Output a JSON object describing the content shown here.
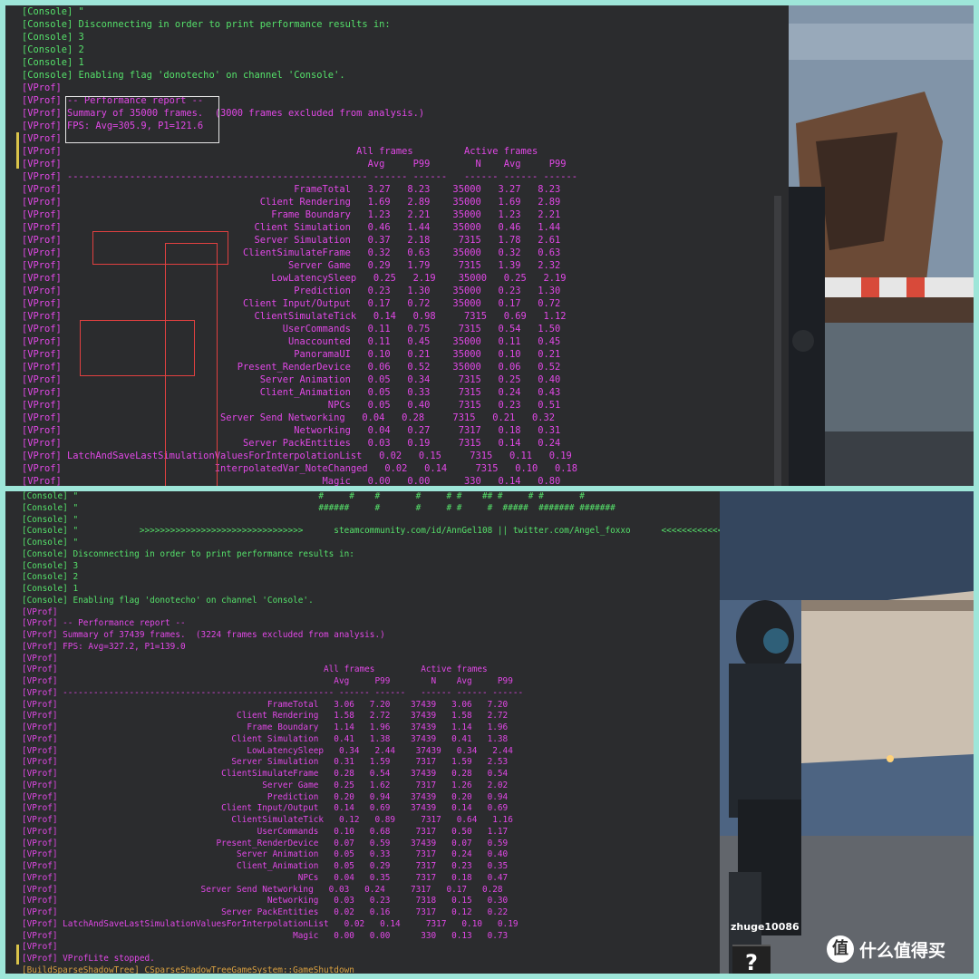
{
  "top_lines": [
    {
      "type": "console",
      "text": "[Console] \""
    },
    {
      "type": "console",
      "text": "[Console] Disconnecting in order to print performance results in:"
    },
    {
      "type": "console",
      "text": "[Console] 3"
    },
    {
      "type": "console",
      "text": "[Console] 2"
    },
    {
      "type": "console",
      "text": "[Console] 1"
    },
    {
      "type": "console",
      "text": "[Console] Enabling flag 'donotecho' on channel 'Console'."
    },
    {
      "type": "vprof",
      "text": "[VProf]"
    },
    {
      "type": "vprof",
      "text": "[VProf] -- Performance report --"
    },
    {
      "type": "vprof",
      "text": "[VProf] Summary of 35000 frames.  (3000 frames excluded from analysis.)"
    },
    {
      "type": "vprof",
      "text": "[VProf] FPS: Avg=305.9, P1=121.6"
    },
    {
      "type": "vprof",
      "text": "[VProf]"
    },
    {
      "type": "vprof",
      "text": "[VProf]                                                    All frames         Active frames"
    },
    {
      "type": "vprof",
      "text": "[VProf]                                                      Avg     P99        N    Avg     P99"
    },
    {
      "type": "vprof",
      "text": "[VProf] ----------------------------------------------------- ------ ------   ------ ------ ------"
    },
    {
      "type": "vprof",
      "text": "[VProf]                                         FrameTotal   3.27   8.23    35000   3.27   8.23"
    },
    {
      "type": "vprof",
      "text": "[VProf]                                   Client Rendering   1.69   2.89    35000   1.69   2.89"
    },
    {
      "type": "vprof",
      "text": "[VProf]                                     Frame Boundary   1.23   2.21    35000   1.23   2.21"
    },
    {
      "type": "vprof",
      "text": "[VProf]                                  Client Simulation   0.46   1.44    35000   0.46   1.44"
    },
    {
      "type": "vprof",
      "text": "[VProf]                                  Server Simulation   0.37   2.18     7315   1.78   2.61"
    },
    {
      "type": "vprof",
      "text": "[VProf]                                ClientSimulateFrame   0.32   0.63    35000   0.32   0.63"
    },
    {
      "type": "vprof",
      "text": "[VProf]                                        Server Game   0.29   1.79     7315   1.39   2.32"
    },
    {
      "type": "vprof",
      "text": "[VProf]                                     LowLatencySleep   0.25   2.19    35000   0.25   2.19"
    },
    {
      "type": "vprof",
      "text": "[VProf]                                         Prediction   0.23   1.30    35000   0.23   1.30"
    },
    {
      "type": "vprof",
      "text": "[VProf]                                Client Input/Output   0.17   0.72    35000   0.17   0.72"
    },
    {
      "type": "vprof",
      "text": "[VProf]                                  ClientSimulateTick   0.14   0.98     7315   0.69   1.12"
    },
    {
      "type": "vprof",
      "text": "[VProf]                                       UserCommands   0.11   0.75     7315   0.54   1.50"
    },
    {
      "type": "vprof",
      "text": "[VProf]                                        Unaccounted   0.11   0.45    35000   0.11   0.45"
    },
    {
      "type": "vprof",
      "text": "[VProf]                                         PanoramaUI   0.10   0.21    35000   0.10   0.21"
    },
    {
      "type": "vprof",
      "text": "[VProf]                               Present_RenderDevice   0.06   0.52    35000   0.06   0.52"
    },
    {
      "type": "vprof",
      "text": "[VProf]                                   Server Animation   0.05   0.34     7315   0.25   0.40"
    },
    {
      "type": "vprof",
      "text": "[VProf]                                   Client_Animation   0.05   0.33     7315   0.24   0.43"
    },
    {
      "type": "vprof",
      "text": "[VProf]                                               NPCs   0.05   0.40     7315   0.23   0.51"
    },
    {
      "type": "vprof",
      "text": "[VProf]                            Server Send Networking   0.04   0.28     7315   0.21   0.32"
    },
    {
      "type": "vprof",
      "text": "[VProf]                                         Networking   0.04   0.27     7317   0.18   0.31"
    },
    {
      "type": "vprof",
      "text": "[VProf]                                Server PackEntities   0.03   0.19     7315   0.14   0.24"
    },
    {
      "type": "vprof",
      "text": "[VProf] LatchAndSaveLastSimulationValuesForInterpolationList   0.02   0.15     7315   0.11   0.19"
    },
    {
      "type": "vprof",
      "text": "[VProf]                           InterpolatedVar_NoteChanged   0.02   0.14     7315   0.10   0.18"
    },
    {
      "type": "vprof",
      "text": "[VProf]                                              Magic   0.00   0.00      330   0.14   0.80"
    }
  ],
  "bottom_lines": [
    {
      "type": "console",
      "text": "[Console] \"                                               #     #    #       #     # #    ## #     # #       #"
    },
    {
      "type": "console",
      "text": "[Console] \"                                               ######     #       #     # #     #  #####  ####### #######"
    },
    {
      "type": "console",
      "text": "[Console] \""
    },
    {
      "type": "console",
      "text": "[Console] \"            >>>>>>>>>>>>>>>>>>>>>>>>>>>>>>>>      steamcommunity.com/id/AnnGel108 || twitter.com/Angel_foxxo      <<<<<<<<<<<<<<<<<"
    },
    {
      "type": "console",
      "text": "[Console] \""
    },
    {
      "type": "console",
      "text": "[Console] Disconnecting in order to print performance results in:"
    },
    {
      "type": "console",
      "text": "[Console] 3"
    },
    {
      "type": "console",
      "text": "[Console] 2"
    },
    {
      "type": "console",
      "text": "[Console] 1"
    },
    {
      "type": "console",
      "text": "[Console] Enabling flag 'donotecho' on channel 'Console'."
    },
    {
      "type": "vprof",
      "text": "[VProf]"
    },
    {
      "type": "vprof",
      "text": "[VProf] -- Performance report --"
    },
    {
      "type": "vprof",
      "text": "[VProf] Summary of 37439 frames.  (3224 frames excluded from analysis.)"
    },
    {
      "type": "vprof",
      "text": "[VProf] FPS: Avg=327.2, P1=139.0"
    },
    {
      "type": "vprof",
      "text": "[VProf]"
    },
    {
      "type": "vprof",
      "text": "[VProf]                                                    All frames         Active frames"
    },
    {
      "type": "vprof",
      "text": "[VProf]                                                      Avg     P99        N    Avg     P99"
    },
    {
      "type": "vprof",
      "text": "[VProf] ----------------------------------------------------- ------ ------   ------ ------ ------"
    },
    {
      "type": "vprof",
      "text": "[VProf]                                         FrameTotal   3.06   7.20    37439   3.06   7.20"
    },
    {
      "type": "vprof",
      "text": "[VProf]                                   Client Rendering   1.58   2.72    37439   1.58   2.72"
    },
    {
      "type": "vprof",
      "text": "[VProf]                                     Frame Boundary   1.14   1.96    37439   1.14   1.96"
    },
    {
      "type": "vprof",
      "text": "[VProf]                                  Client Simulation   0.41   1.38    37439   0.41   1.38"
    },
    {
      "type": "vprof",
      "text": "[VProf]                                     LowLatencySleep   0.34   2.44    37439   0.34   2.44"
    },
    {
      "type": "vprof",
      "text": "[VProf]                                  Server Simulation   0.31   1.59     7317   1.59   2.53"
    },
    {
      "type": "vprof",
      "text": "[VProf]                                ClientSimulateFrame   0.28   0.54    37439   0.28   0.54"
    },
    {
      "type": "vprof",
      "text": "[VProf]                                        Server Game   0.25   1.62     7317   1.26   2.02"
    },
    {
      "type": "vprof",
      "text": "[VProf]                                         Prediction   0.20   0.94    37439   0.20   0.94"
    },
    {
      "type": "vprof",
      "text": "[VProf]                                Client Input/Output   0.14   0.69    37439   0.14   0.69"
    },
    {
      "type": "vprof",
      "text": "[VProf]                                  ClientSimulateTick   0.12   0.89     7317   0.64   1.16"
    },
    {
      "type": "vprof",
      "text": "[VProf]                                       UserCommands   0.10   0.68     7317   0.50   1.17"
    },
    {
      "type": "vprof",
      "text": "[VProf]                               Present_RenderDevice   0.07   0.59    37439   0.07   0.59"
    },
    {
      "type": "vprof",
      "text": "[VProf]                                   Server Animation   0.05   0.33     7317   0.24   0.40"
    },
    {
      "type": "vprof",
      "text": "[VProf]                                   Client_Animation   0.05   0.29     7317   0.23   0.35"
    },
    {
      "type": "vprof",
      "text": "[VProf]                                               NPCs   0.04   0.35     7317   0.18   0.47"
    },
    {
      "type": "vprof",
      "text": "[VProf]                            Server Send Networking   0.03   0.24     7317   0.17   0.28"
    },
    {
      "type": "vprof",
      "text": "[VProf]                                         Networking   0.03   0.23     7318   0.15   0.30"
    },
    {
      "type": "vprof",
      "text": "[VProf]                                Server PackEntities   0.02   0.16     7317   0.12   0.22"
    },
    {
      "type": "vprof",
      "text": "[VProf] LatchAndSaveLastSimulationValuesForInterpolationList   0.02   0.14     7317   0.10   0.19"
    },
    {
      "type": "vprof",
      "text": "[VProf]                                              Magic   0.00   0.00      330   0.13   0.73"
    },
    {
      "type": "vprof",
      "text": "[VProf]"
    },
    {
      "type": "vprof",
      "text": "[VProf] VProfLite stopped."
    },
    {
      "type": "build",
      "text": "[BuildSparseShadowTree] CSparseShadowTreeGameSystem::GameShutdown"
    }
  ],
  "player_name": "zhuge10086",
  "hud_glyph": "?",
  "watermark": {
    "logo_char": "值",
    "text": "什么值得买"
  },
  "colors": {
    "console": "#55e06a",
    "vprof": "#e148e6",
    "build": "#d9a040",
    "highlight_red": "#e04040",
    "highlight_white": "#e6e6e6",
    "border": "#9ee6d9"
  }
}
